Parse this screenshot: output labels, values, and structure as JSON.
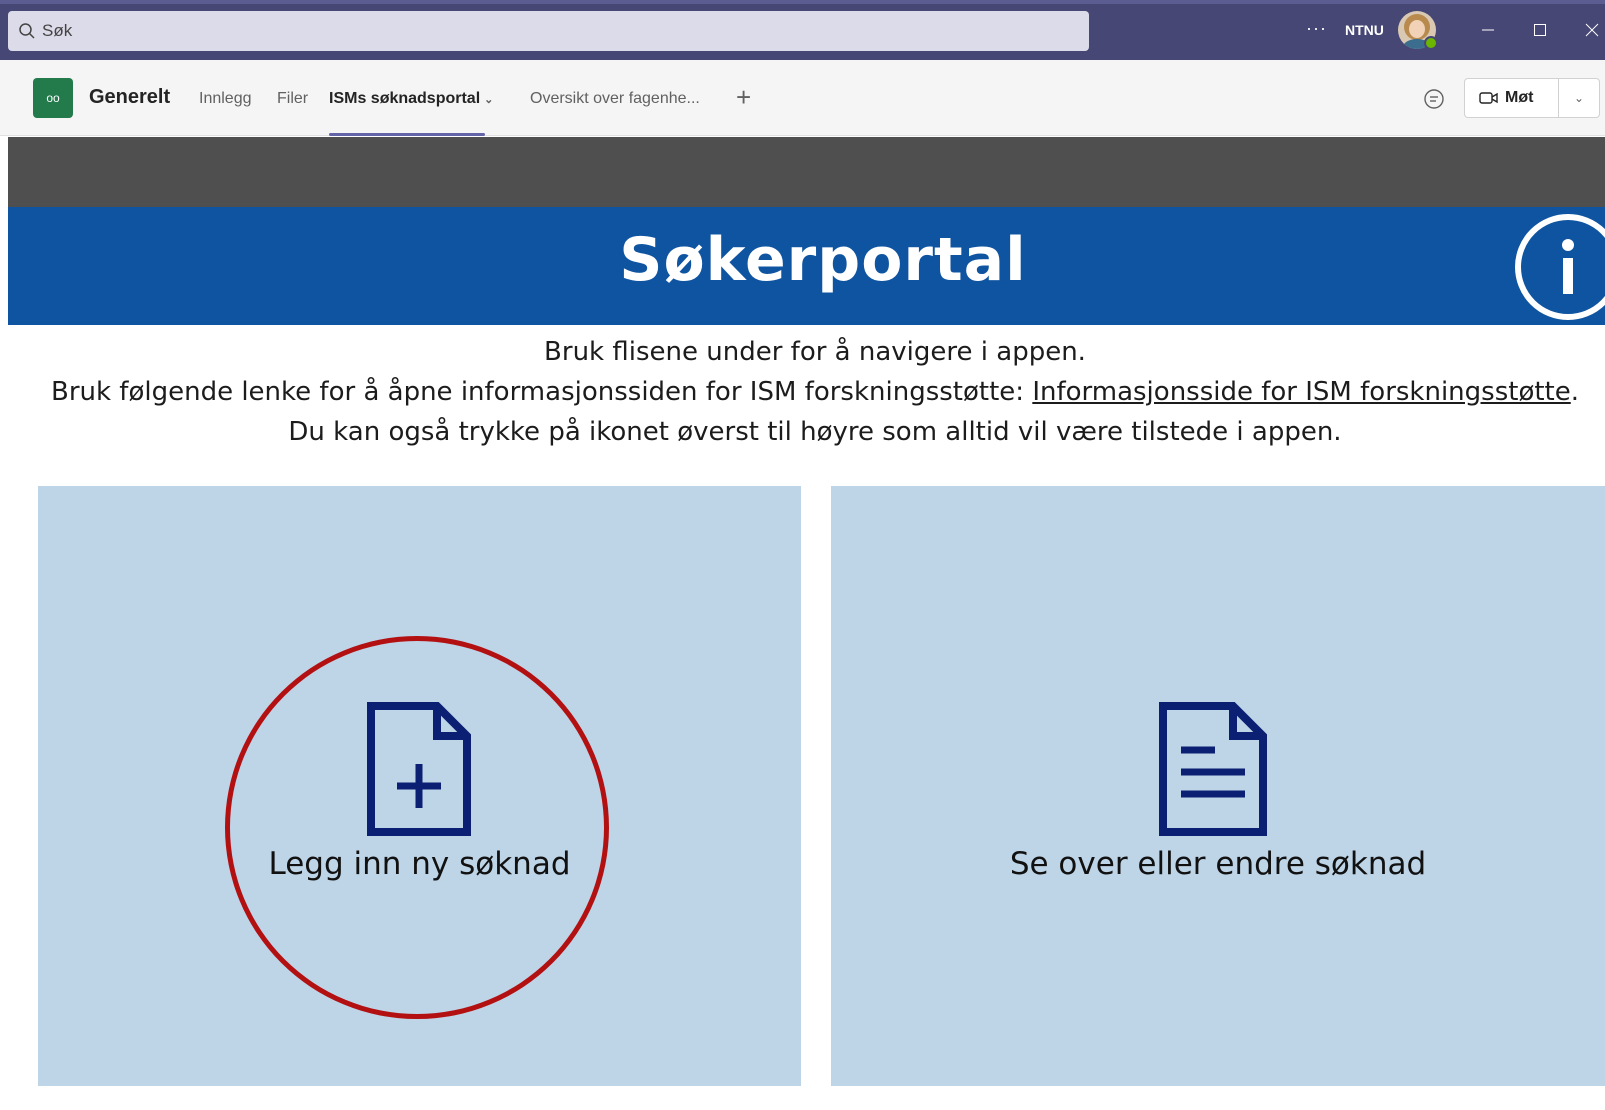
{
  "titlebar": {
    "search_placeholder": "Søk",
    "more": "···",
    "org": "NTNU"
  },
  "channel": {
    "team_icon_text": "oo",
    "name": "Generelt",
    "tabs": [
      {
        "label": "Innlegg"
      },
      {
        "label": "Filer"
      },
      {
        "label": "ISMs søknadsportal",
        "active": true
      },
      {
        "label": "Oversikt over fagenhe..."
      }
    ],
    "meet_label": "Møt"
  },
  "app": {
    "title": "Søkerportal",
    "intro_line1": "Bruk flisene under for å navigere i appen.",
    "intro_line2_prefix": "Bruk følgende lenke for å åpne informasjonssiden for ISM forskningsstøtte: ",
    "intro_link": "Informasjonsside for ISM forskningsstøtte",
    "intro_line2_suffix": ".",
    "intro_line3": "Du kan også trykke på ikonet øverst til høyre som alltid vil være tilstede i appen.",
    "tiles": [
      {
        "label": "Legg inn ny søknad",
        "icon": "new-document-icon"
      },
      {
        "label": "Se over eller endre søknad",
        "icon": "document-icon"
      }
    ]
  },
  "colors": {
    "teams_purple": "#464775",
    "banner_blue": "#0f54a0",
    "tile_bg": "#bed4e7",
    "icon_navy": "#0b1f73",
    "annotation_red": "#b31012"
  }
}
